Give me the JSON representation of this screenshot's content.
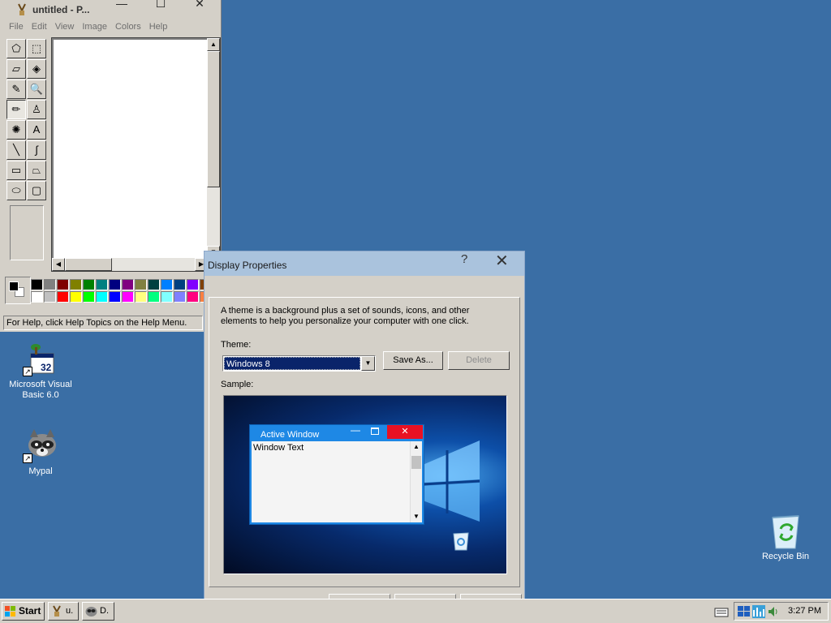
{
  "paint": {
    "title": "untitled - P...",
    "menu": [
      "File",
      "Edit",
      "View",
      "Image",
      "Colors",
      "Help"
    ],
    "status": "For Help, click Help Topics on the Help Menu.",
    "tools": [
      {
        "name": "free-select-icon",
        "glyph": "⬠"
      },
      {
        "name": "rect-select-icon",
        "glyph": "⬚"
      },
      {
        "name": "eraser-icon",
        "glyph": "▱"
      },
      {
        "name": "fill-bucket-icon",
        "glyph": "◈"
      },
      {
        "name": "color-picker-icon",
        "glyph": "✎"
      },
      {
        "name": "magnifier-icon",
        "glyph": "🔍"
      },
      {
        "name": "pencil-icon",
        "glyph": "✏"
      },
      {
        "name": "brush-icon",
        "glyph": "♙"
      },
      {
        "name": "airbrush-icon",
        "glyph": "✺"
      },
      {
        "name": "text-icon",
        "glyph": "A"
      },
      {
        "name": "line-icon",
        "glyph": "╲"
      },
      {
        "name": "curve-icon",
        "glyph": "∫"
      },
      {
        "name": "rectangle-icon",
        "glyph": "▭"
      },
      {
        "name": "polygon-icon",
        "glyph": "⏢"
      },
      {
        "name": "ellipse-icon",
        "glyph": "⬭"
      },
      {
        "name": "rounded-rect-icon",
        "glyph": "▢"
      }
    ],
    "palette_top": [
      "#000000",
      "#808080",
      "#800000",
      "#808000",
      "#008000",
      "#008080",
      "#000080",
      "#800080",
      "#808040",
      "#004040",
      "#0080ff",
      "#004080",
      "#8000ff",
      "#804000"
    ],
    "palette_bottom": [
      "#ffffff",
      "#c0c0c0",
      "#ff0000",
      "#ffff00",
      "#00ff00",
      "#00ffff",
      "#0000ff",
      "#ff00ff",
      "#ffff80",
      "#00ff80",
      "#80ffff",
      "#8080ff",
      "#ff0080",
      "#ff8040"
    ]
  },
  "desktop": {
    "icons": [
      {
        "label": "Microsoft Visual Basic 6.0"
      },
      {
        "label": "Mypal"
      },
      {
        "label": "Recycle Bin"
      }
    ]
  },
  "dialog": {
    "title": "Display Properties",
    "help": "?",
    "close": "✕",
    "description": "A theme is a background plus a set of sounds, icons, and other elements to help you personalize your computer with one click.",
    "theme_label": "Theme:",
    "theme_value": "Windows 8",
    "save_as": "Save As...",
    "delete": "Delete",
    "sample_label": "Sample:",
    "sample": {
      "window_title": "Active Window",
      "window_text": "Window Text"
    }
  },
  "taskbar": {
    "start": "Start",
    "tasks": [
      {
        "label": "u."
      },
      {
        "label": "D."
      }
    ],
    "clock": "3:27 PM"
  }
}
